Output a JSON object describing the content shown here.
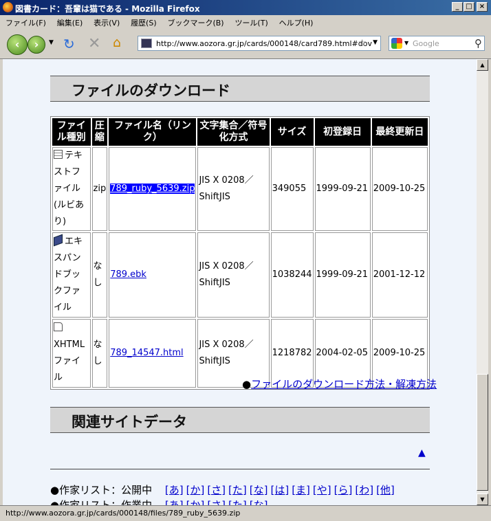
{
  "window": {
    "title": "図書カード：吾輩は猫である - Mozilla Firefox",
    "min": "_",
    "max": "□",
    "close": "×"
  },
  "menu": [
    "ファイル(F)",
    "編集(E)",
    "表示(V)",
    "履歴(S)",
    "ブックマーク(B)",
    "ツール(T)",
    "ヘルプ(H)"
  ],
  "toolbar": {
    "url": "http://www.aozora.gr.jp/cards/000148/card789.html#dov",
    "search_placeholder": "Google"
  },
  "page": {
    "download_heading": "ファイルのダウンロード",
    "table": {
      "headers": [
        "ファイル種別",
        "圧縮",
        "ファイル名（リンク）",
        "文字集合／符号化方式",
        "サイズ",
        "初登録日",
        "最終更新日"
      ],
      "rows": [
        {
          "type": "テキストファイル(ルビあり)",
          "icon": "text-file-icon",
          "compress": "zip",
          "file": "789_ruby_5639.zip",
          "charset": "JIS X 0208／ShiftJIS",
          "size": "349055",
          "created": "1999-09-21",
          "updated": "2009-10-25"
        },
        {
          "type": "エキスパンドブックファイル",
          "icon": "book-icon",
          "compress": "なし",
          "file": "789.ebk",
          "charset": "JIS X 0208／ShiftJIS",
          "size": "1038244",
          "created": "1999-09-21",
          "updated": "2001-12-12"
        },
        {
          "type": "XHTMLファイル",
          "icon": "html-file-icon",
          "compress": "なし",
          "file": "789_14547.html",
          "charset": "JIS X 0208／ShiftJIS",
          "size": "1218782",
          "created": "2004-02-05",
          "updated": "2009-10-25"
        }
      ]
    },
    "howto_bullet": "●",
    "howto_link": "ファイルのダウンロード方法・解凍方法",
    "related_heading": "関連サイトデータ",
    "to_top": "▲",
    "author_list_label": "●作家リスト：公開中",
    "author_list_label2": "●作家リスト：作業中",
    "kana": [
      "[あ]",
      "[か]",
      "[さ]",
      "[た]",
      "[な]",
      "[は]",
      "[ま]",
      "[や]",
      "[ら]",
      "[わ]",
      "[他]"
    ]
  },
  "status": "http://www.aozora.gr.jp/cards/000148/files/789_ruby_5639.zip"
}
